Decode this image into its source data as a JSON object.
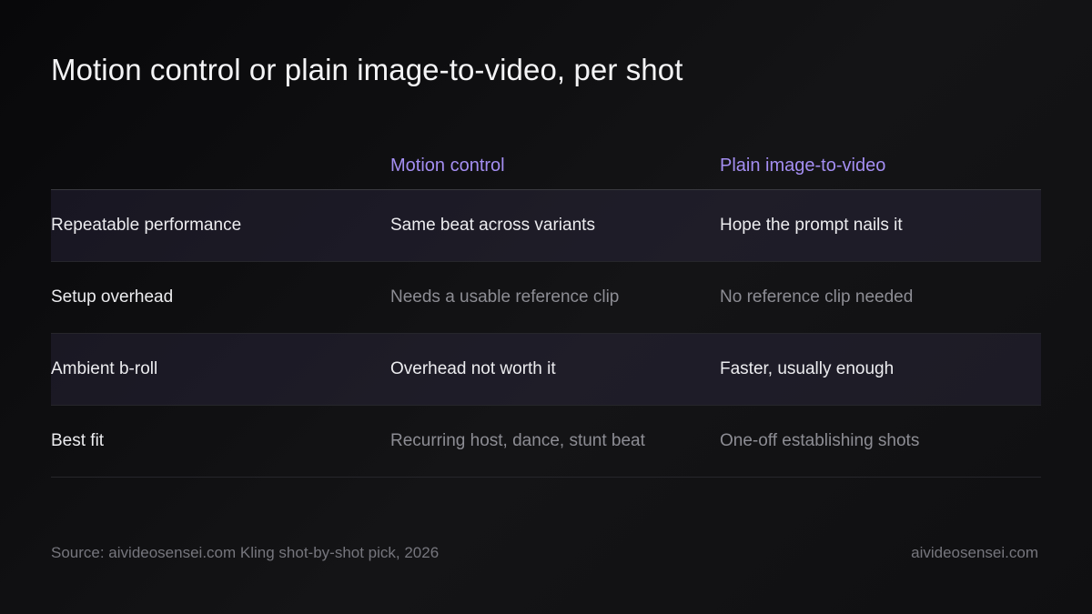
{
  "title": "Motion control or plain image-to-video, per shot",
  "table": {
    "headers": [
      "",
      "Motion control",
      "Plain image-to-video"
    ],
    "rows": [
      {
        "label": "Repeatable performance",
        "motion": "Same beat across variants",
        "plain": "Hope the prompt nails it"
      },
      {
        "label": "Setup overhead",
        "motion": "Needs a usable reference clip",
        "plain": "No reference clip needed"
      },
      {
        "label": "Ambient b-roll",
        "motion": "Overhead not worth it",
        "plain": "Faster, usually enough"
      },
      {
        "label": "Best fit",
        "motion": "Recurring host, dance, stunt beat",
        "plain": "One-off establishing shots"
      }
    ]
  },
  "footer": {
    "source": "Source: aivideosensei.com Kling shot-by-shot pick, 2026",
    "brand": "aivideosensei.com"
  },
  "colors": {
    "background": "#0e0e10",
    "accent": "#a48ef2",
    "shaded_row": "#1e1c28",
    "text": "#ececef",
    "muted_text": "#8d8d94"
  }
}
